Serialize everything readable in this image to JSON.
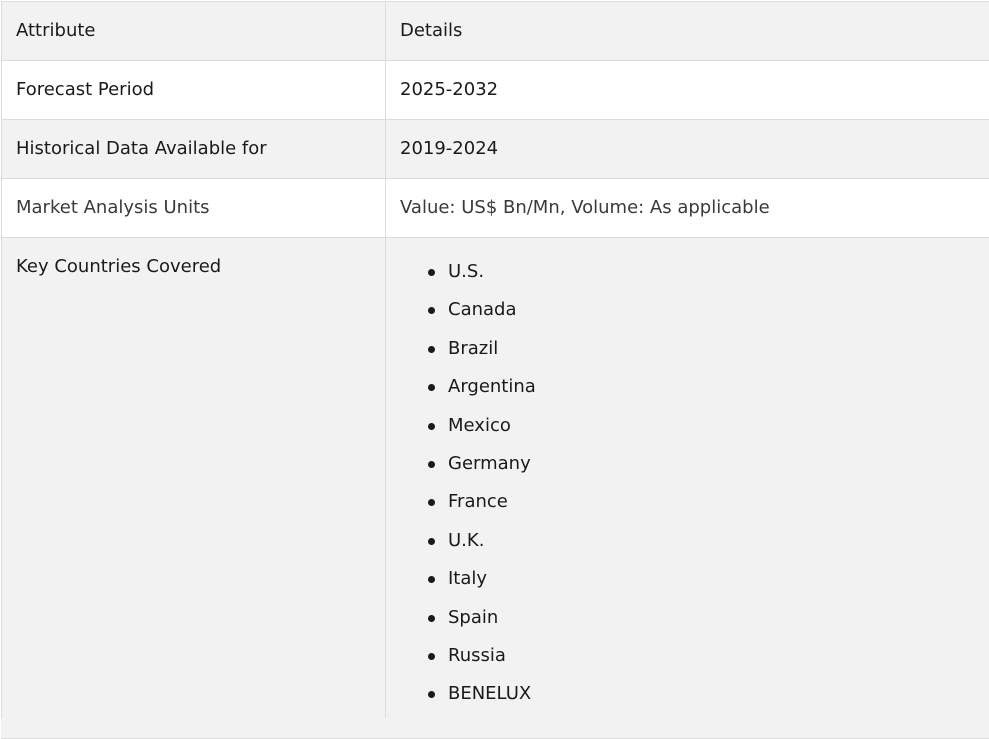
{
  "table": {
    "header": {
      "attribute": "Attribute",
      "details": "Details"
    },
    "rows": [
      {
        "attribute": "Forecast Period",
        "details": "2025-2032"
      },
      {
        "attribute": "Historical Data Available for",
        "details": "2019-2024"
      },
      {
        "attribute": "Market Analysis Units",
        "details": "Value: US$ Bn/Mn, Volume: As applicable"
      }
    ],
    "countries": {
      "attribute": "Key Countries Covered",
      "items": [
        "U.S.",
        "Canada",
        "Brazil",
        "Argentina",
        "Mexico",
        "Germany",
        "France",
        "U.K.",
        "Italy",
        "Spain",
        "Russia",
        "BENELUX"
      ]
    }
  }
}
